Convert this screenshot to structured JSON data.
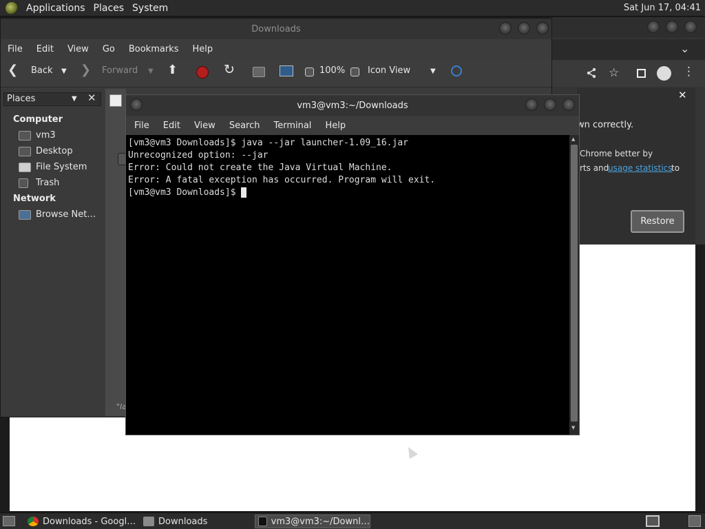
{
  "top_panel": {
    "menus": [
      "Applications",
      "Places",
      "System"
    ],
    "clock": "Sat Jun 17, 04:41"
  },
  "chrome": {
    "info_text1": "wn correctly.",
    "info_text2": "Chrome better by",
    "info_text3": "rts and",
    "info_link": "usage statistics",
    "info_text4": "to",
    "restore_label": "Restore",
    "close_glyph": "✕",
    "expand_glyph": "⌄"
  },
  "file_manager": {
    "title": "Downloads",
    "menus": [
      "File",
      "Edit",
      "View",
      "Go",
      "Bookmarks",
      "Help"
    ],
    "back_label": "Back",
    "forward_label": "Forward",
    "zoom": "100%",
    "view_mode": "Icon View",
    "side_header": "Places",
    "computer_header": "Computer",
    "computer_items": [
      "vm3",
      "Desktop",
      "File System",
      "Trash"
    ],
    "network_header": "Network",
    "network_items": [
      "Browse Net…"
    ],
    "status_snippet": "\"la"
  },
  "terminal": {
    "title": "vm3@vm3:~/Downloads",
    "menus": [
      "File",
      "Edit",
      "View",
      "Search",
      "Terminal",
      "Help"
    ],
    "lines": [
      "[vm3@vm3 Downloads]$ java --jar launcher-1.09_16.jar",
      "Unrecognized option: --jar",
      "Error: Could not create the Java Virtual Machine.",
      "Error: A fatal exception has occurred. Program will exit.",
      "[vm3@vm3 Downloads]$ "
    ]
  },
  "taskbar": {
    "items": [
      "Downloads - Googl…",
      "Downloads",
      "vm3@vm3:~/Downl…"
    ]
  },
  "colors": {
    "link": "#4aa3df",
    "terminal_bg": "#000000",
    "panel_bg": "#2b2b2b"
  }
}
